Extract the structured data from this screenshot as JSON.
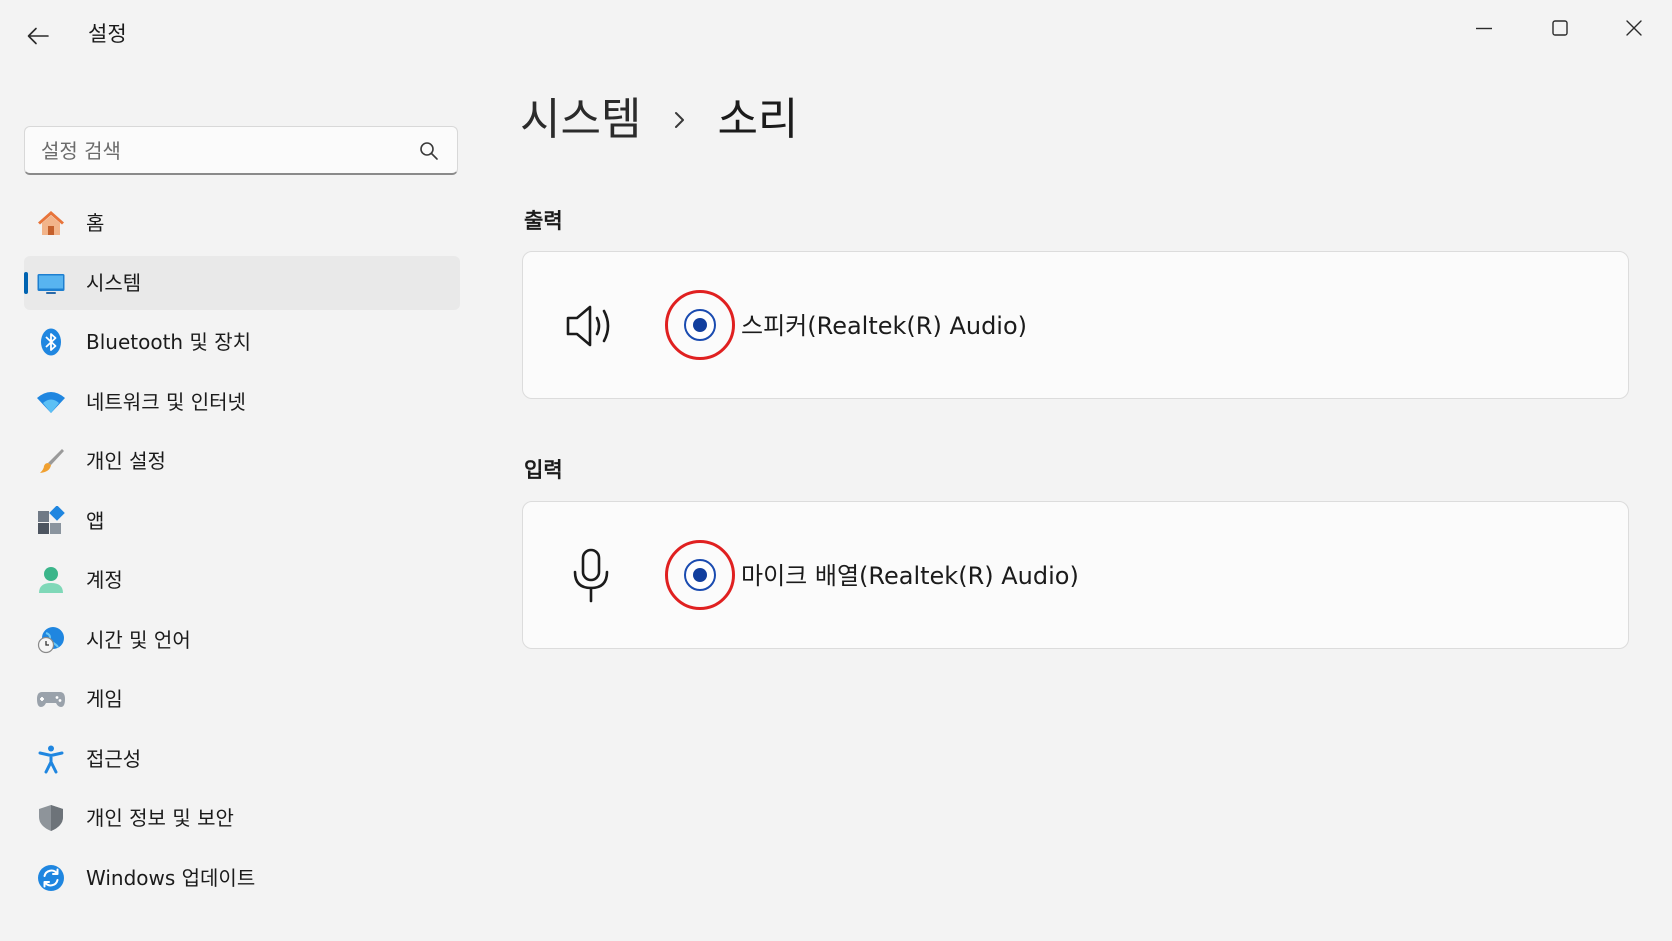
{
  "window": {
    "title": "설정",
    "controls": {
      "back_icon": "arrow-left-icon",
      "minimize_icon": "minimize-icon",
      "maximize_icon": "maximize-icon",
      "close_icon": "close-icon"
    }
  },
  "search": {
    "placeholder": "설정 검색",
    "value": "",
    "icon": "search-icon"
  },
  "sidebar": {
    "active_index": 1,
    "accent_color": "#0063b1",
    "items": [
      {
        "label": "홈",
        "icon": "home-icon"
      },
      {
        "label": "시스템",
        "icon": "monitor-icon"
      },
      {
        "label": "Bluetooth 및 장치",
        "icon": "bluetooth-icon"
      },
      {
        "label": "네트워크 및 인터넷",
        "icon": "wifi-icon"
      },
      {
        "label": "개인 설정",
        "icon": "paintbrush-icon"
      },
      {
        "label": "앱",
        "icon": "apps-icon"
      },
      {
        "label": "계정",
        "icon": "person-icon"
      },
      {
        "label": "시간 및 언어",
        "icon": "clock-globe-icon"
      },
      {
        "label": "게임",
        "icon": "gamepad-icon"
      },
      {
        "label": "접근성",
        "icon": "accessibility-icon"
      },
      {
        "label": "개인 정보 및 보안",
        "icon": "shield-icon"
      },
      {
        "label": "Windows 업데이트",
        "icon": "update-icon"
      }
    ]
  },
  "breadcrumb": {
    "parent": "시스템",
    "separator_icon": "chevron-right-icon",
    "current": "소리"
  },
  "output": {
    "heading": "출력",
    "device": {
      "label": "스피커(Realtek(R) Audio)",
      "icon": "speaker-icon",
      "selected": true
    }
  },
  "input": {
    "heading": "입력",
    "device": {
      "label": "마이크 배열(Realtek(R) Audio)",
      "icon": "microphone-icon",
      "selected": true
    }
  },
  "highlight_color": "#e02020",
  "radio_color": "#123f9e"
}
